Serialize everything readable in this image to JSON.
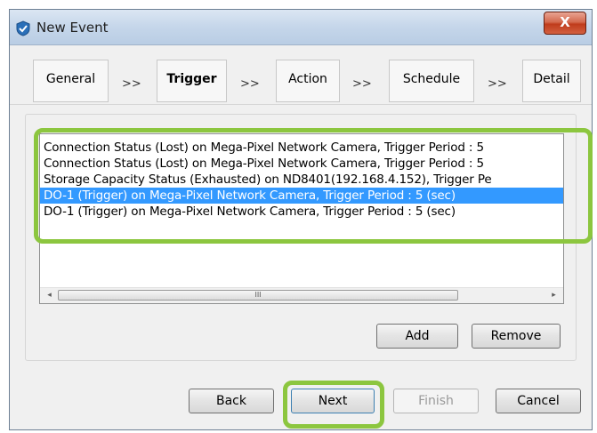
{
  "window": {
    "title": "New Event",
    "close_glyph": "X"
  },
  "tabs": [
    {
      "label": "General",
      "active": false
    },
    {
      "label": "Trigger",
      "active": true
    },
    {
      "label": "Action",
      "active": false
    },
    {
      "label": "Schedule",
      "active": false
    },
    {
      "label": "Detail",
      "active": false
    }
  ],
  "tab_separator": ">>",
  "trigger_list": {
    "rows": [
      {
        "text": "Connection Status (Lost)  on Mega-Pixel Network Camera, Trigger Period : 5",
        "selected": false
      },
      {
        "text": "Connection Status (Lost)  on Mega-Pixel Network Camera, Trigger Period : 5",
        "selected": false
      },
      {
        "text": "Storage Capacity Status (Exhausted)  on ND8401(192.168.4.152), Trigger Pe",
        "selected": false
      },
      {
        "text": "DO-1 (Trigger)  on Mega-Pixel Network Camera, Trigger Period : 5 (sec)",
        "selected": true
      },
      {
        "text": "DO-1 (Trigger)  on Mega-Pixel Network Camera, Trigger Period : 5 (sec)",
        "selected": false
      }
    ],
    "scroll_left_glyph": "◂",
    "scroll_right_glyph": "▸",
    "scroll_grip": "III"
  },
  "list_buttons": {
    "add": "Add",
    "remove": "Remove"
  },
  "footer_buttons": {
    "back": "Back",
    "next": "Next",
    "finish": "Finish",
    "cancel": "Cancel"
  },
  "colors": {
    "highlight": "#8cc63f",
    "selection": "#3399ff"
  },
  "icons": {
    "app": "check-shield-icon",
    "close": "close-icon"
  }
}
